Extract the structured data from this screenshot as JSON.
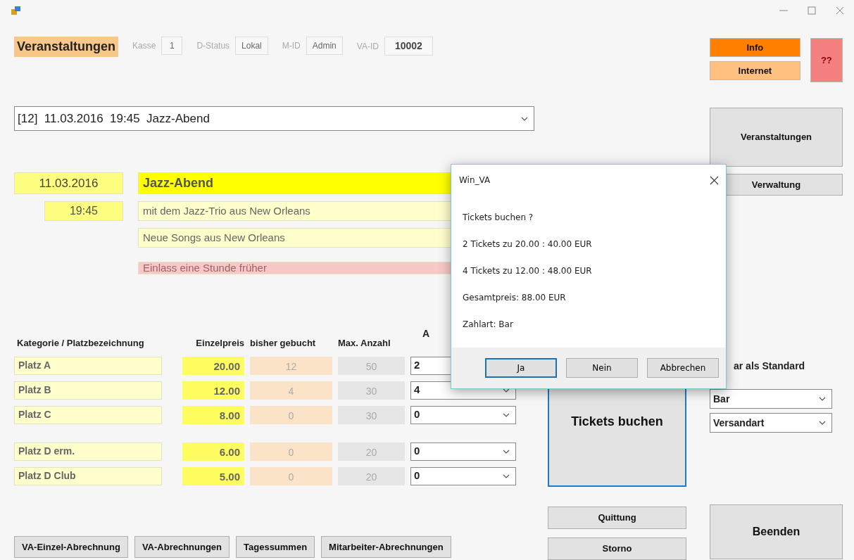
{
  "header": {
    "title": "Veranstaltungen",
    "fields": [
      {
        "label": "Kasse",
        "value": "1",
        "emphasized": false
      },
      {
        "label": "D-Status",
        "value": "Lokal",
        "emphasized": false
      },
      {
        "label": "M-ID",
        "value": "Admin",
        "emphasized": false
      },
      {
        "label": "VA-ID",
        "value": "10002",
        "emphasized": true
      }
    ]
  },
  "event_select": {
    "value": "[12]  11.03.2016  19:45  Jazz-Abend"
  },
  "event": {
    "date": "11.03.2016",
    "time": "19:45",
    "title": "Jazz-Abend",
    "subtitle_1": "mit dem Jazz-Trio aus New Orleans",
    "subtitle_2": "Neue Songs aus New Orleans",
    "note": "Einlass eine Stunde früher"
  },
  "categories": {
    "columns": [
      "Kategorie / Platzbezeichnung",
      "Einzelpreis",
      "bisher gebucht",
      "Max. Anzahl",
      "A"
    ],
    "row_groups": [
      [
        {
          "name": "Platz A",
          "price": "20.00",
          "booked": "12",
          "max": "50",
          "quantity": "2"
        },
        {
          "name": "Platz B",
          "price": "12.00",
          "booked": "4",
          "max": "30",
          "quantity": "4"
        },
        {
          "name": "Platz C",
          "price": "8.00",
          "booked": "0",
          "max": "30",
          "quantity": "0"
        }
      ],
      [
        {
          "name": "Platz D erm.",
          "price": "6.00",
          "booked": "0",
          "max": "20",
          "quantity": "0"
        },
        {
          "name": "Platz D Club",
          "price": "5.00",
          "booked": "0",
          "max": "20",
          "quantity": "0"
        }
      ]
    ]
  },
  "booking_button": "Tickets buchen",
  "side_buttons": [
    {
      "label": "Info",
      "color": "#ff8000"
    },
    {
      "label": "Internet",
      "color": "#ffc080"
    },
    {
      "label": "??",
      "color": "#f58080"
    }
  ],
  "nav_buttons": [
    "Veranstaltungen",
    "Verwaltung"
  ],
  "payment": {
    "label": "ar als Standard",
    "method": "Bar",
    "shipping": "Versandart"
  },
  "report_buttons": [
    "VA-Einzel-Abrechnung",
    "VA-Abrechnungen",
    "Tagessummen",
    "Mitarbeiter-Abrechnungen"
  ],
  "receipt_buttons": [
    "Quittung",
    "Storno"
  ],
  "exit_button": "Beenden",
  "dialog": {
    "title": "Win_VA",
    "lines": [
      "Tickets buchen ?",
      "2 Tickets zu 20.00 :  40.00 EUR",
      "4 Tickets zu 12.00 :  48.00 EUR",
      "Gesamtpreis: 88.00 EUR",
      "Zahlart: Bar"
    ],
    "buttons": [
      {
        "label": "Ja",
        "focused": true
      },
      {
        "label": "Nein",
        "focused": false
      },
      {
        "label": "Abbrechen",
        "focused": false
      }
    ]
  }
}
